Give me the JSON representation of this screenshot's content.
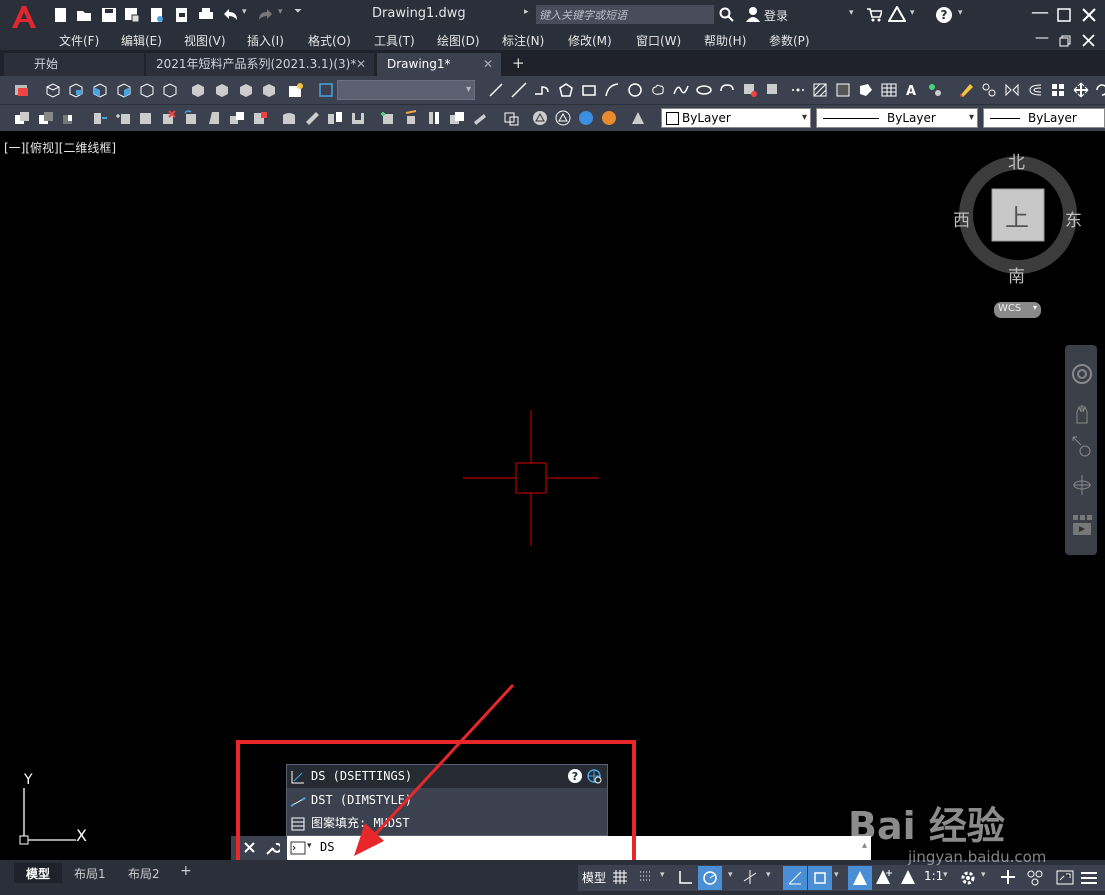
{
  "title": {
    "doc_name": "Drawing1.dwg",
    "search_placeholder": "键入关键字或短语",
    "login_label": "登录"
  },
  "menu": {
    "items": [
      "文件(F)",
      "编辑(E)",
      "视图(V)",
      "插入(I)",
      "格式(O)",
      "工具(T)",
      "绘图(D)",
      "标注(N)",
      "修改(M)",
      "窗口(W)",
      "帮助(H)",
      "参数(P)"
    ]
  },
  "tabs": {
    "start": "开始",
    "file1": "2021年短料产品系列(2021.3.1)(3)*",
    "file2": "Drawing1*",
    "add": "+"
  },
  "layer_props": {
    "color": "ByLayer",
    "linetype": "ByLayer",
    "lineweight": "ByLayer"
  },
  "viewport": {
    "label": "[一][俯视][二维线框]"
  },
  "viewcube": {
    "north": "北",
    "south": "南",
    "east": "东",
    "west": "西",
    "face": "上",
    "wcs": "WCS"
  },
  "ucs": {
    "x_label": "X",
    "y_label": "Y"
  },
  "autocomplete": {
    "items": [
      {
        "text": "DS (DSETTINGS)"
      },
      {
        "text": "DST (DIMSTYLE)"
      },
      {
        "text": "图案填充: MUDST"
      }
    ]
  },
  "command": {
    "value": "DS"
  },
  "layout_tabs": [
    "模型",
    "布局1",
    "布局2",
    "+"
  ],
  "status": {
    "model": "模型",
    "scale": "1:1"
  },
  "watermark": {
    "text": "Bai 经验",
    "url": "jingyan.baidu.com"
  },
  "colors": {
    "accent_red": "#e8272b",
    "crosshair": "#d40000",
    "ui_dark": "#2b2f3a"
  }
}
